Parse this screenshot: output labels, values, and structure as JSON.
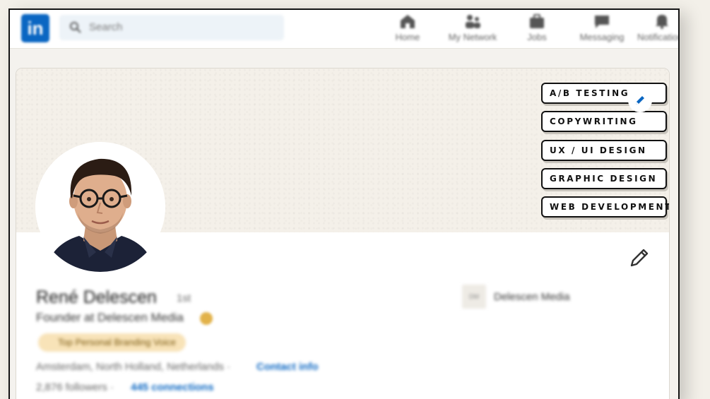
{
  "nav": {
    "logo_text": "in",
    "search_placeholder": "Search",
    "items": [
      {
        "label": "Home",
        "icon": "home-icon"
      },
      {
        "label": "My Network",
        "icon": "network-icon"
      },
      {
        "label": "Jobs",
        "icon": "jobs-icon"
      },
      {
        "label": "Messaging",
        "icon": "messaging-icon"
      },
      {
        "label": "Notifications",
        "icon": "bell-icon"
      }
    ]
  },
  "banner": {
    "tags": [
      "A/B TESTING",
      "COPYWRITING",
      "UX / UI  DESIGN",
      "GRAPHIC DESIGN",
      "WEB DEVELOPMENT"
    ],
    "edit_icon": "pencil-icon"
  },
  "profile": {
    "name": "René Delescen",
    "degree": "1st",
    "headline": "Founder at Delescen Media",
    "badge": "Top Personal Branding Voice",
    "location": "Amsterdam, North Holland, Netherlands ·",
    "contact_link": "Contact info",
    "followers": "2,876 followers ·",
    "connections": "445 connections",
    "company_logo_text": "DM",
    "company": "Delescen Media",
    "edit_icon": "pencil-icon"
  },
  "colors": {
    "brand": "#0a66c2",
    "banner_bg": "#f4f0e9",
    "badge_bg": "#f8e3b8"
  }
}
